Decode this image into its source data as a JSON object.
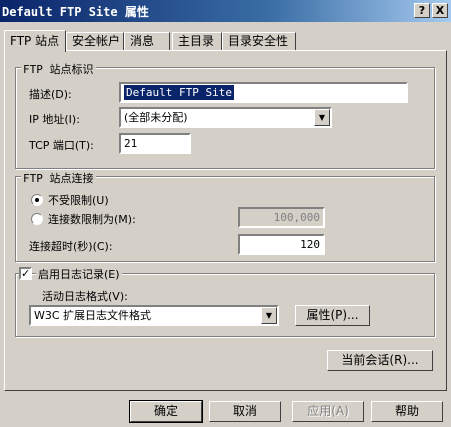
{
  "window": {
    "title": "Default FTP Site 属性",
    "help_label": "?",
    "close_label": "X"
  },
  "tabs": [
    {
      "label": "FTP 站点",
      "active": true
    },
    {
      "label": "安全帐户"
    },
    {
      "label": "消息"
    },
    {
      "label": "主目录"
    },
    {
      "label": "目录安全性"
    }
  ],
  "site_id": {
    "legend": "FTP 站点标识",
    "description_label": "描述(D):",
    "description_value": "Default FTP Site",
    "ip_label": "IP 地址(I):",
    "ip_value": "(全部未分配)",
    "port_label": "TCP 端口(T):",
    "port_value": "21"
  },
  "connections": {
    "legend": "FTP 站点连接",
    "unlimited_label": "不受限制(U)",
    "limited_label": "连接数限制为(M):",
    "limit_value": "100,000",
    "timeout_label": "连接超时(秒)(C):",
    "timeout_value": "120"
  },
  "logging": {
    "enable_label": "启用日志记录(E)",
    "enabled": true,
    "format_label": "活动日志格式(V):",
    "format_value": "W3C 扩展日志文件格式",
    "properties_label": "属性(P)..."
  },
  "current_sessions_label": "当前会话(R)...",
  "footer": {
    "ok_label": "确定",
    "cancel_label": "取消",
    "apply_label": "应用(A)",
    "help_label": "帮助"
  }
}
